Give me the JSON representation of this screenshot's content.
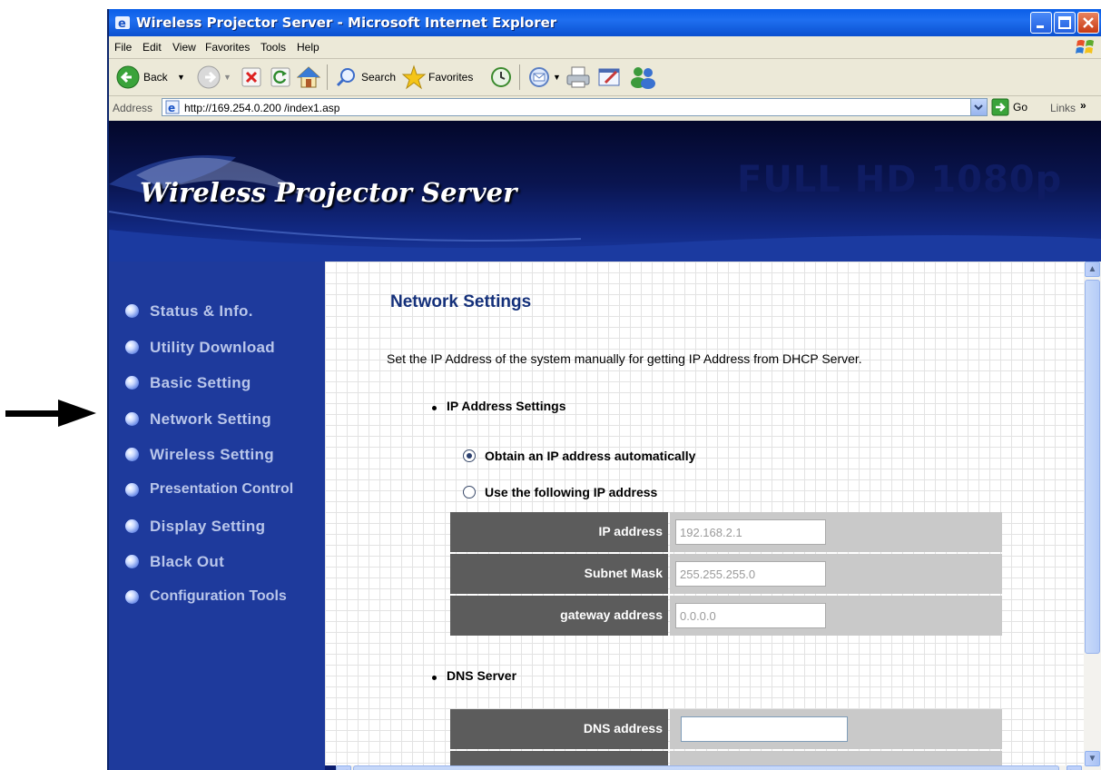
{
  "window": {
    "title": "Wireless Projector Server - Microsoft Internet Explorer"
  },
  "menu": [
    "File",
    "Edit",
    "View",
    "Favorites",
    "Tools",
    "Help"
  ],
  "toolbar": {
    "back_label": "Back",
    "search_label": "Search",
    "favorites_label": "Favorites"
  },
  "address": {
    "label": "Address",
    "url": "http://169.254.0.200 /index1.asp",
    "go_label": "Go",
    "links_label": "Links"
  },
  "banner": {
    "brand": "Wireless Projector Server",
    "tagline": "FULL HD 1080p"
  },
  "nav": [
    "Status & Info.",
    "Utility Download",
    "Basic Setting",
    "Network Setting",
    "Wireless Setting",
    "Presentation Control",
    "Display Setting",
    "Black Out",
    "Configuration Tools"
  ],
  "page": {
    "heading": "Network Settings",
    "description": "Set the IP Address of the system manually for getting IP Address from DHCP Server.",
    "ip_section": "IP Address Settings",
    "radio_auto": "Obtain an IP address automatically",
    "radio_manual": "Use the following IP address",
    "selected_mode": "auto",
    "fields": [
      {
        "label": "IP address",
        "value": "192.168.2.1"
      },
      {
        "label": "Subnet Mask",
        "value": "255.255.255.0"
      },
      {
        "label": "gateway address",
        "value": "0.0.0.0"
      }
    ],
    "dns_section": "DNS Server",
    "dns_label": "DNS address",
    "dns_value": ""
  }
}
